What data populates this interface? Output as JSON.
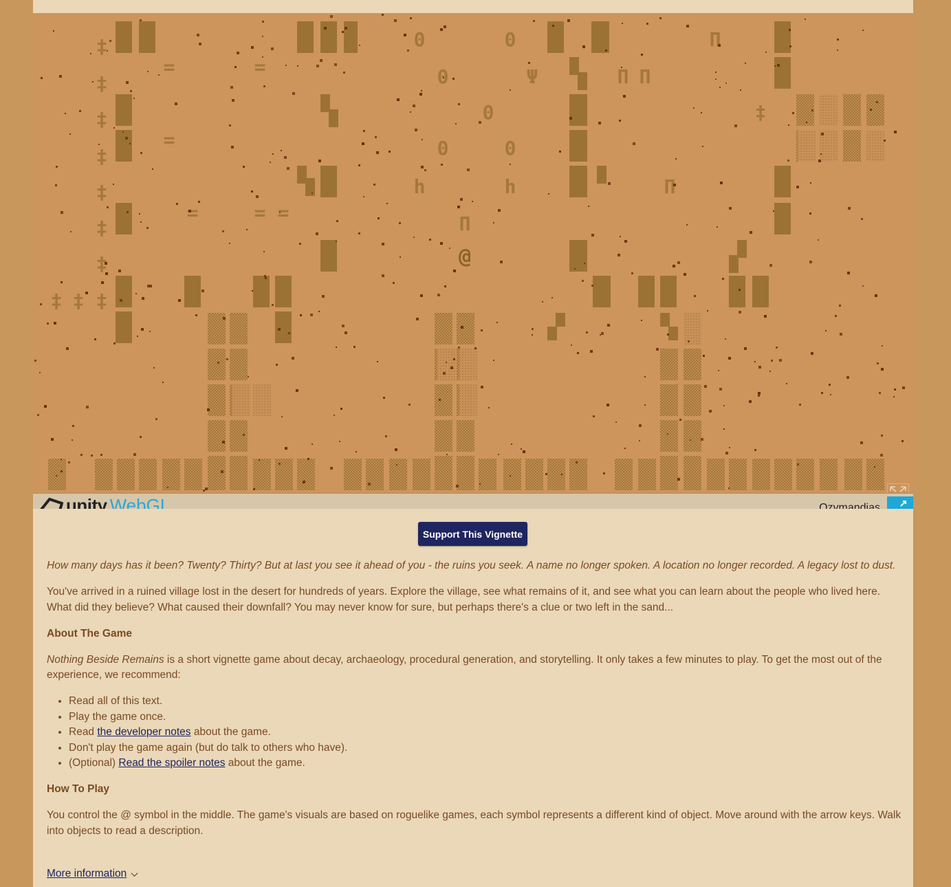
{
  "game": {
    "title": "Ozymandias",
    "engine_logo": "unity",
    "engine_sub": "WebGL",
    "player_glyph": "@",
    "glyphs": {
      "plus": "‡",
      "zero": "0",
      "eq": "=",
      "psi": "Ψ",
      "n": "Π",
      "h": "h"
    }
  },
  "support_button": "Support This Vignette",
  "intro_italic": "How many days has it been? Twenty? Thirty? But at last you see it ahead of you - the ruins you seek. A name no longer spoken. A location no longer recorded. A legacy lost to dust.",
  "intro_text": "You've arrived in a ruined village lost in the desert for hundreds of years. Explore the village, see what remains of it, and see what you can learn about the people who lived here. What did they believe? What caused their downfall? You may never know for sure, but perhaps there's a clue or two left in the sand...",
  "about": {
    "heading": "About The Game",
    "game_name": "Nothing Beside Remains",
    "text": " is a short vignette game about decay, archaeology, procedural generation, and storytelling. It only takes a few minutes to play. To get the most out of the experience, we recommend:",
    "list": {
      "item1": "Read all of this text.",
      "item2": "Play the game once.",
      "item3_pre": "Read ",
      "item3_link": "the developer notes",
      "item3_post": " about the game.",
      "item4": "Don't play the game again (but do talk to others who have).",
      "item5_pre": "(Optional) ",
      "item5_link": "Read the spoiler notes",
      "item5_post": " about the game."
    }
  },
  "howto": {
    "heading": "How To Play",
    "text": "You control the @ symbol in the middle. The game's visuals are based on roguelike games, each symbol represents a different kind of object. Move around with the arrow keys. Walk into objects to read a description."
  },
  "more_info": "More information",
  "colors": {
    "page_bg": "#c8975c",
    "panel_bg": "#ead8b9",
    "sand": "#cd955b",
    "ruin": "#9b7233",
    "pebble": "#6b2e10",
    "button": "#1f2560",
    "text": "#7a4a22",
    "unity_blue": "#2aa7d8"
  }
}
